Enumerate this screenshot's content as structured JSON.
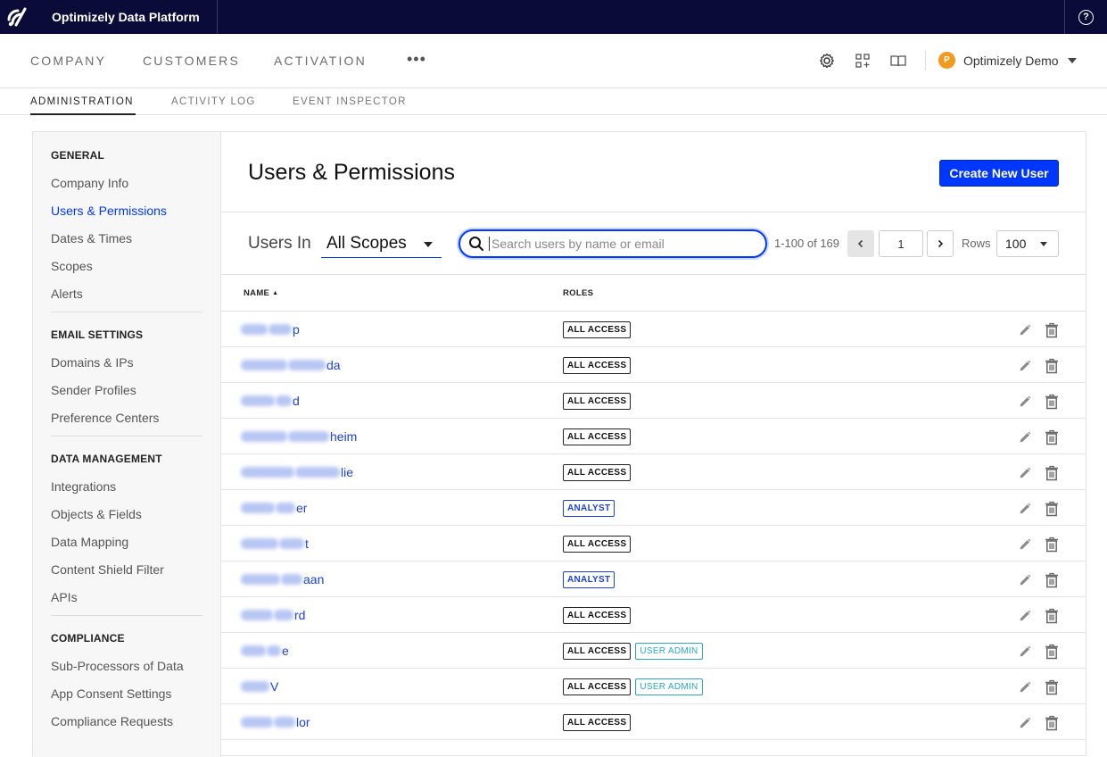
{
  "app": {
    "title": "Optimizely Data Platform"
  },
  "main_nav": {
    "items": [
      "COMPANY",
      "CUSTOMERS",
      "ACTIVATION"
    ],
    "more_label": "•••",
    "account": {
      "initial": "P",
      "name": "Optimizely Demo"
    }
  },
  "sub_nav": {
    "items": [
      "ADMINISTRATION",
      "ACTIVITY LOG",
      "EVENT INSPECTOR"
    ],
    "active": "ADMINISTRATION"
  },
  "sidebar": {
    "sections": [
      {
        "heading": "GENERAL",
        "items": [
          "Company Info",
          "Users & Permissions",
          "Dates & Times",
          "Scopes",
          "Alerts"
        ]
      },
      {
        "heading": "EMAIL SETTINGS",
        "items": [
          "Domains & IPs",
          "Sender Profiles",
          "Preference Centers"
        ]
      },
      {
        "heading": "DATA MANAGEMENT",
        "items": [
          "Integrations",
          "Objects & Fields",
          "Data Mapping",
          "Content Shield Filter",
          "APIs"
        ]
      },
      {
        "heading": "COMPLIANCE",
        "items": [
          "Sub-Processors of Data",
          "App Consent Settings",
          "Compliance Requests"
        ]
      }
    ],
    "active_item": "Users & Permissions"
  },
  "page": {
    "title": "Users & Permissions",
    "create_button": "Create New User",
    "users_in_label": "Users In",
    "scope_value": "All Scopes",
    "search_placeholder": "Search users by name or email",
    "range_text": "1-100 of 169",
    "page_number": "1",
    "rows_label": "Rows",
    "rows_value": "100",
    "columns": {
      "name": "NAME",
      "roles": "ROLES"
    }
  },
  "users": [
    {
      "visible_suffix": "p",
      "roles": [
        "ALL ACCESS"
      ]
    },
    {
      "visible_suffix": "da",
      "roles": [
        "ALL ACCESS"
      ]
    },
    {
      "visible_suffix": "d",
      "roles": [
        "ALL ACCESS"
      ]
    },
    {
      "visible_suffix": "heim",
      "roles": [
        "ALL ACCESS"
      ]
    },
    {
      "visible_suffix": "lie",
      "roles": [
        "ALL ACCESS"
      ]
    },
    {
      "visible_suffix": "er",
      "roles": [
        "ANALYST"
      ]
    },
    {
      "visible_suffix": "t",
      "roles": [
        "ALL ACCESS"
      ]
    },
    {
      "visible_suffix": "aan",
      "roles": [
        "ANALYST"
      ]
    },
    {
      "visible_suffix": "rd",
      "roles": [
        "ALL ACCESS"
      ]
    },
    {
      "visible_suffix": "e",
      "roles": [
        "ALL ACCESS",
        "USER ADMIN"
      ]
    },
    {
      "visible_suffix": "V",
      "roles": [
        "ALL ACCESS",
        "USER ADMIN"
      ]
    },
    {
      "visible_suffix": "lor",
      "roles": [
        "ALL ACCESS"
      ]
    }
  ],
  "colors": {
    "topbar": "#0b0b3a",
    "accent": "#0037ff",
    "avatar": "#f29a1e",
    "user_admin": "#2aa6c7"
  }
}
